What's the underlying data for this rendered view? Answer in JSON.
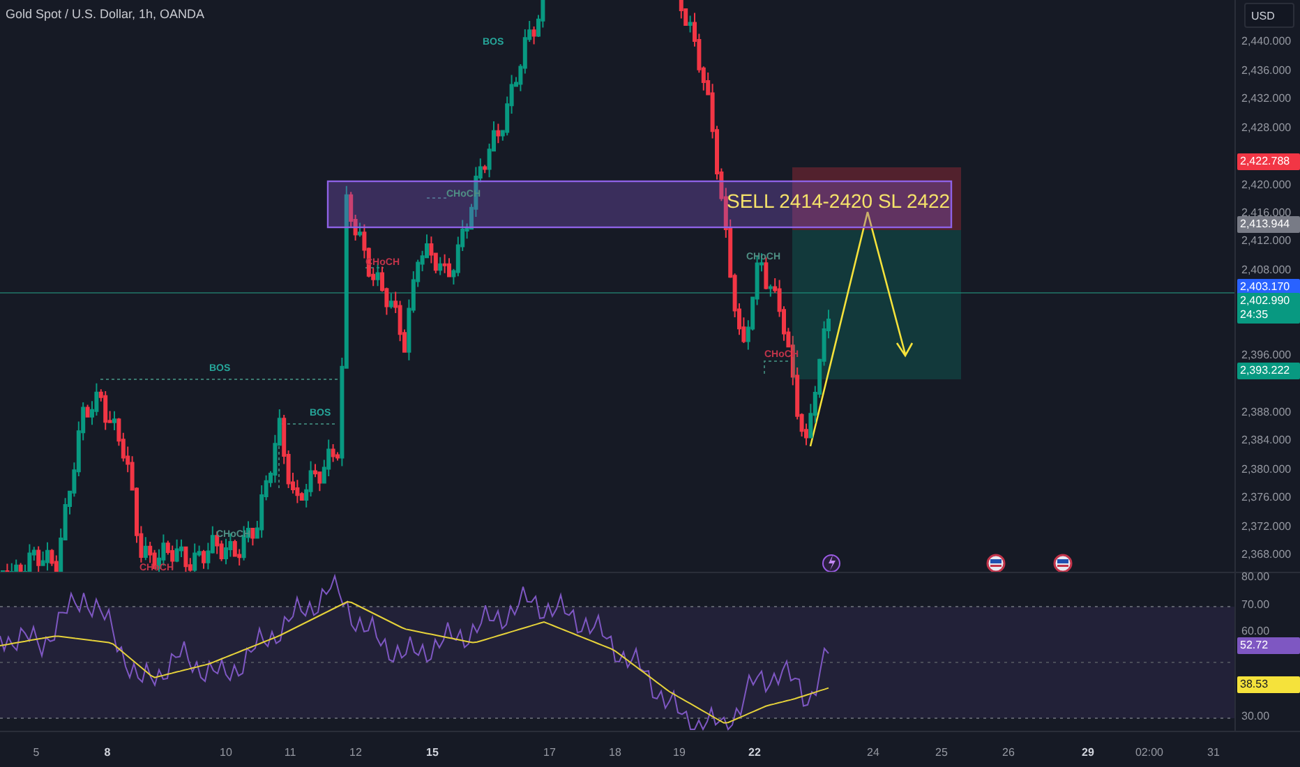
{
  "header": {
    "title": "Gold Spot / U.S. Dollar, 1h, OANDA"
  },
  "currency_button": "USD",
  "price_axis": {
    "ticks": [
      "2,440.000",
      "2,436.000",
      "2,432.000",
      "2,428.000",
      "2,420.000",
      "2,416.000",
      "2,412.000",
      "2,408.000",
      "2,396.000",
      "2,388.000",
      "2,384.000",
      "2,380.000",
      "2,376.000",
      "2,372.000",
      "2,368.000"
    ]
  },
  "price_badges": [
    {
      "text": "2,422.788",
      "color": "#f23645"
    },
    {
      "text": "2,413.944",
      "color": "#787b86"
    },
    {
      "text": "2,403.170",
      "color": "#2962ff"
    },
    {
      "text": "2,402.990",
      "subtext": "24:35",
      "color": "#089981"
    },
    {
      "text": "2,393.222",
      "color": "#089981"
    }
  ],
  "trade_label": "SELL 2414-2420 SL 2422",
  "structure_labels": [
    {
      "text": "BOS",
      "color": "#26a69a"
    },
    {
      "text": "BOS",
      "color": "#26a69a"
    },
    {
      "text": "BOS",
      "color": "#26a69a"
    },
    {
      "text": "CHoCH",
      "color": "#4f8f84"
    },
    {
      "text": "CHoCH",
      "color": "#c2344a"
    },
    {
      "text": "CHoCH",
      "color": "#4f8f84"
    },
    {
      "text": "CHoCH",
      "color": "#c2344a"
    },
    {
      "text": "CHoCH",
      "color": "#4f8f84"
    },
    {
      "text": "CHoCH",
      "color": "#c2344a"
    }
  ],
  "events": [
    {
      "kind": "lightning"
    },
    {
      "kind": "flag"
    },
    {
      "kind": "flag"
    }
  ],
  "rsi": {
    "ticks": [
      "80.00",
      "70.00",
      "60.00",
      "30.00"
    ],
    "badges": [
      {
        "text": "52.72",
        "color": "#7e57c2"
      },
      {
        "text": "38.53",
        "color": "#f5e23b"
      }
    ]
  },
  "time_axis": [
    {
      "text": "5",
      "bold": false
    },
    {
      "text": "8",
      "bold": true
    },
    {
      "text": "10",
      "bold": false
    },
    {
      "text": "11",
      "bold": false
    },
    {
      "text": "12",
      "bold": false
    },
    {
      "text": "15",
      "bold": true
    },
    {
      "text": "17",
      "bold": false
    },
    {
      "text": "18",
      "bold": false
    },
    {
      "text": "19",
      "bold": false
    },
    {
      "text": "22",
      "bold": true
    },
    {
      "text": "24",
      "bold": false
    },
    {
      "text": "25",
      "bold": false
    },
    {
      "text": "26",
      "bold": false
    },
    {
      "text": "29",
      "bold": true
    },
    {
      "text": "02:00",
      "bold": false
    },
    {
      "text": "31",
      "bold": false
    }
  ]
}
